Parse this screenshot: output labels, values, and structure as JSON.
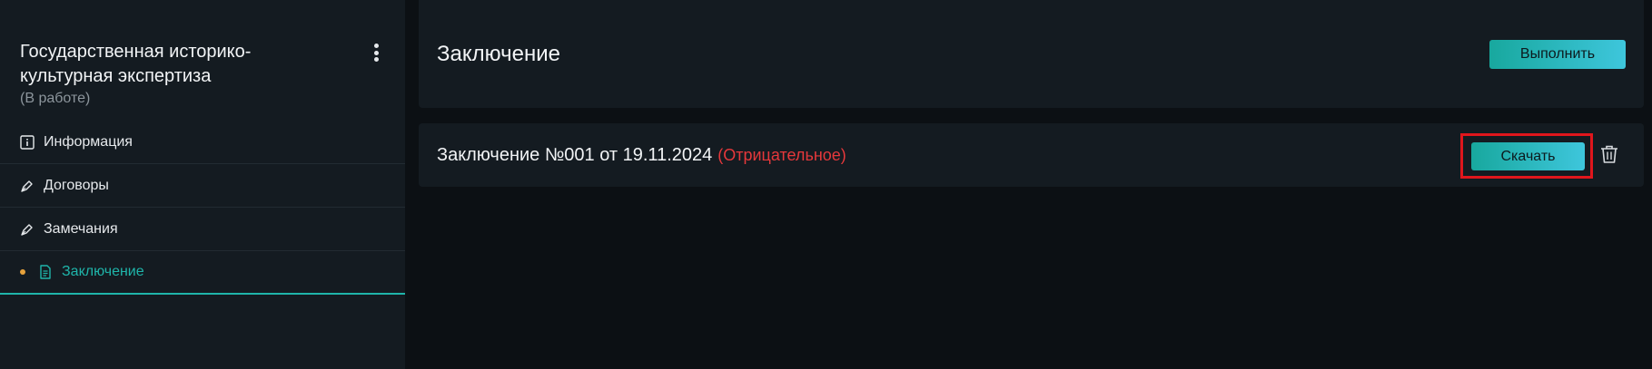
{
  "sidebar": {
    "title": "Государственная историко-культурная экспертиза",
    "status": "(В работе)",
    "items": [
      {
        "label": "Информация",
        "icon": "info-icon"
      },
      {
        "label": "Договоры",
        "icon": "pen-icon"
      },
      {
        "label": "Замечания",
        "icon": "pen-icon"
      },
      {
        "label": "Заключение",
        "icon": "document-icon",
        "active": true
      }
    ]
  },
  "header": {
    "title": "Заключение",
    "execute_label": "Выполнить"
  },
  "document": {
    "title": "Заключение №001 от 19.11.2024",
    "status": "(Отрицательное)",
    "download_label": "Скачать"
  },
  "colors": {
    "accent": "#1fb5aa",
    "negative": "#e5383b",
    "highlight": "#e0161c",
    "active_dot": "#e6a23c"
  }
}
